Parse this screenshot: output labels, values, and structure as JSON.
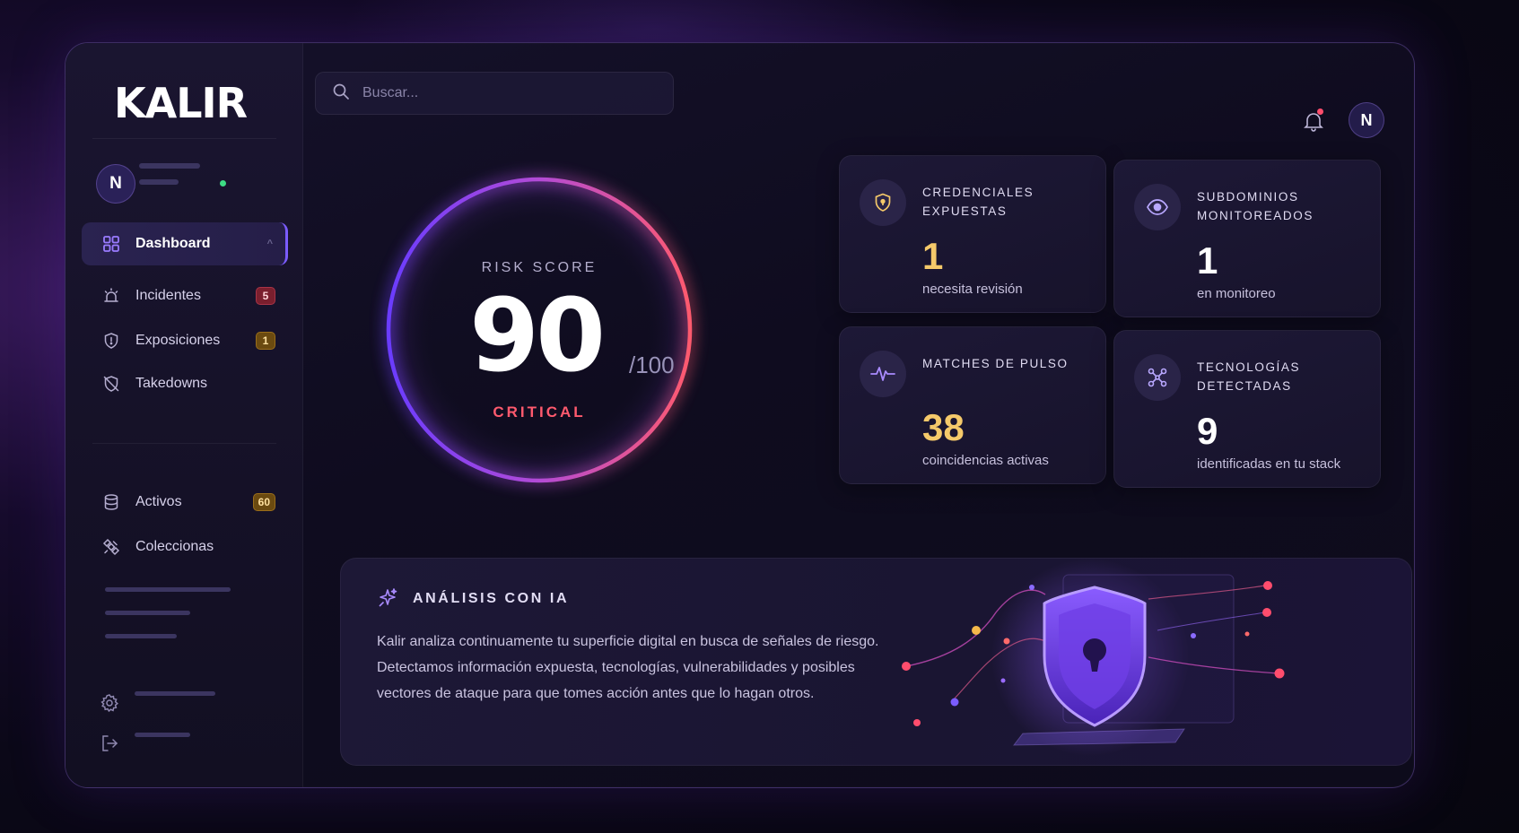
{
  "app": {
    "logo": "KALIR",
    "user_initial": "N"
  },
  "search": {
    "placeholder": "Buscar..."
  },
  "sidebar": {
    "items": [
      {
        "label": "Dashboard",
        "icon": "grid-icon",
        "active": true
      },
      {
        "label": "Incidentes",
        "icon": "alert-light-icon",
        "badge": "5",
        "badge_color": "#7a1f2e"
      },
      {
        "label": "Exposiciones",
        "icon": "shield-alert-icon",
        "badge": "1",
        "badge_color": "#6b4a10"
      },
      {
        "label": "Takedowns",
        "icon": "shield-off-icon"
      },
      {
        "label": "Activos",
        "icon": "database-icon",
        "badge": "60",
        "badge_color": "#6b4a10"
      },
      {
        "label": "Coleccionas",
        "icon": "satellite-icon"
      }
    ],
    "footer_icons": [
      "settings-icon",
      "logout-icon"
    ]
  },
  "risk": {
    "label": "RISK SCORE",
    "score": "90",
    "max": "/100",
    "level": "CRITICAL",
    "score_value": 90
  },
  "cards": [
    {
      "title": "CREDENCIALES EXPUESTAS",
      "value": "1",
      "sub": "necesita revisión",
      "value_color": "#f5c96a",
      "icon": "shield-key-icon"
    },
    {
      "title": "SUBDOMINIOS MONITOREADOS",
      "value": "1",
      "sub": "en monitoreo",
      "value_color": "#ffffff",
      "icon": "eye-icon"
    },
    {
      "title": "MATCHES DE PULSO",
      "value": "38",
      "sub": "coincidencias activas",
      "value_color": "#f5c96a",
      "icon": "pulse-icon"
    },
    {
      "title": "TECNOLOGÍAS DETECTADAS",
      "value": "9",
      "sub": "identificadas en tu stack",
      "value_color": "#ffffff",
      "icon": "network-icon"
    }
  ],
  "ai": {
    "title": "ANÁLISIS CON IA",
    "text": "Kalir analiza continuamente tu superficie digital en busca de señales de riesgo. Detectamos información expuesta, tecnologías, vulnerabilidades y posibles vectores de ataque para que tomes acción antes que lo hagan otros."
  },
  "colors": {
    "accent": "#7b5cff",
    "critical": "#ff5a6e",
    "amber": "#f5c96a",
    "online": "#3ddc84"
  }
}
